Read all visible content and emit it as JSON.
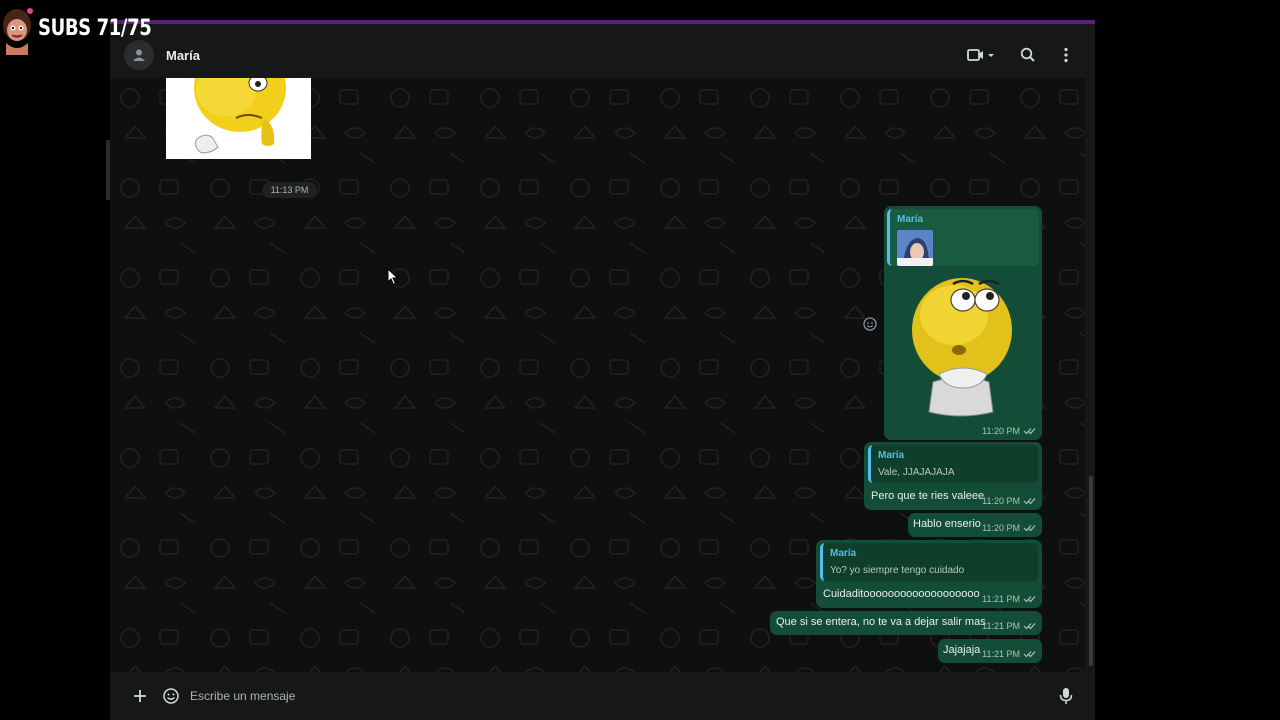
{
  "overlay": {
    "subs_text": "SUBS 71/75"
  },
  "header": {
    "contact_name": "María"
  },
  "messages": {
    "incoming_sticker_time": "11:13 PM",
    "sticker_reply": {
      "quote_name": "María",
      "time": "11:20 PM"
    },
    "msg1": {
      "quote_name": "María",
      "quote_text": "Vale, JJAJAJAJA",
      "text": "Pero que te ries valeee",
      "time": "11:20 PM"
    },
    "msg2": {
      "text": "Hablo enserio",
      "time": "11:20 PM"
    },
    "msg3": {
      "quote_name": "María",
      "quote_text": "Yo? yo siempre tengo cuidado",
      "text": "Cuidaditooooooooooooooooooo",
      "time": "11:21 PM"
    },
    "msg4": {
      "text": "Que si se entera, no te va a dejar salir mas",
      "time": "11:21 PM"
    },
    "msg5": {
      "text": "Jajajaja",
      "time": "11:21 PM"
    }
  },
  "composer": {
    "placeholder": "Escribe un mensaje"
  },
  "colors": {
    "accent_purple": "#5a1f7a",
    "bubble_out": "#144d37",
    "quote_bar": "#53bdeb",
    "background": "#0e0f0f"
  },
  "icons": [
    "default-avatar-icon",
    "video-call-icon",
    "search-icon",
    "menu-icon",
    "reaction-icon",
    "double-check-icon",
    "plus-icon",
    "emoji-icon",
    "microphone-icon"
  ]
}
